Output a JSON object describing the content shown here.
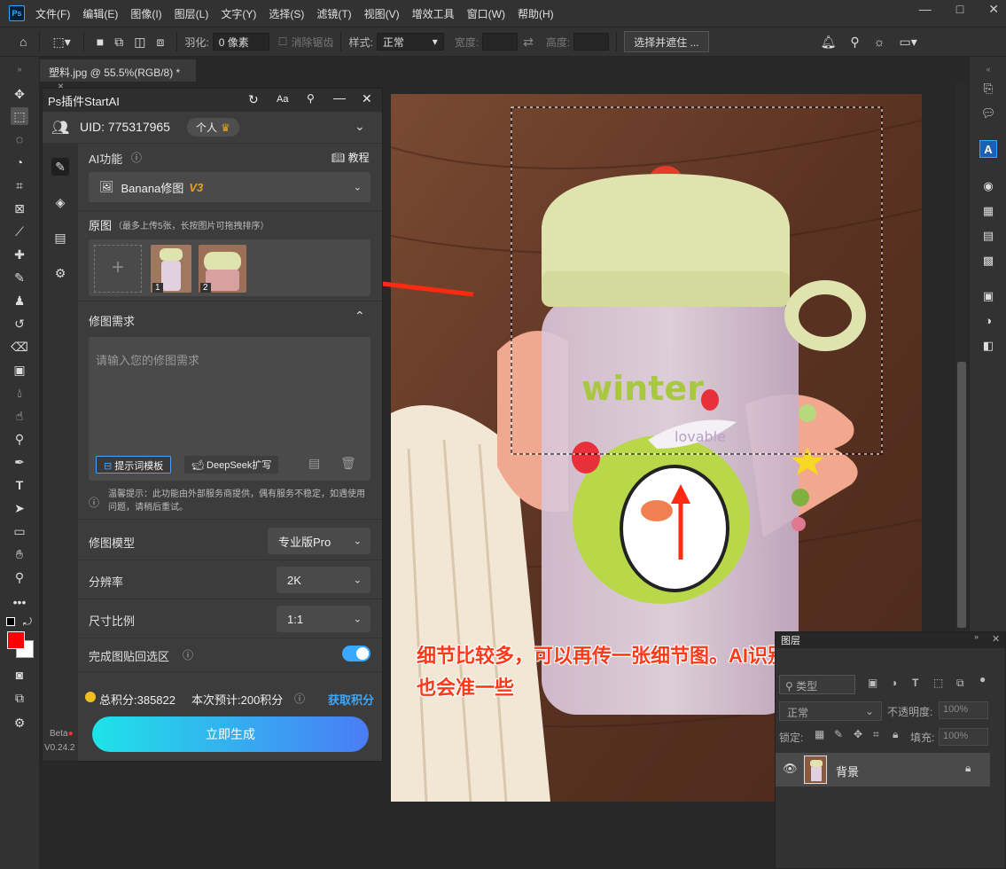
{
  "app": {
    "logo": "Ps"
  },
  "menus": [
    "文件(F)",
    "编辑(E)",
    "图像(I)",
    "图层(L)",
    "文字(Y)",
    "选择(S)",
    "滤镜(T)",
    "视图(V)",
    "增效工具",
    "窗口(W)",
    "帮助(H)"
  ],
  "window_controls": {
    "minimize": "—",
    "restore": "□",
    "close": "✕"
  },
  "options": {
    "feather_label": "羽化:",
    "feather_value": "0 像素",
    "antialias_label": "消除锯齿",
    "style_label": "样式:",
    "style_value": "正常",
    "width_label": "宽度:",
    "height_label": "高度:",
    "select_mask_button": "选择并遮住 ..."
  },
  "document_tab": {
    "title": "塑料.jpg @ 55.5%(RGB/8) *",
    "close": "×"
  },
  "plugin": {
    "title": "Ps插件StartAI",
    "font_btn": "Aa",
    "uid_label": "UID: 775317965",
    "account_type": "个人",
    "ai_func_label": "AI功能",
    "tutorial_label": "教程",
    "func_name": "Banana修图",
    "func_version": "V3",
    "source_label": "原图",
    "source_hint": "（最多上传5张，长按图片可拖拽排序）",
    "thumb_1_index": "1",
    "thumb_2_index": "2",
    "add_symbol": "+",
    "requirements_label": "修图需求",
    "requirements_placeholder": "请输入您的修图需求",
    "prompt_template_btn": "提示词模板",
    "deepseek_btn": "DeepSeek扩写",
    "notice": "温馨提示：此功能由外部服务商提供，偶有服务不稳定，如遇使用问题，请稍后重试。",
    "model_label": "修图模型",
    "model_value": "专业版Pro",
    "resolution_label": "分辨率",
    "resolution_value": "2K",
    "ratio_label": "尺寸比例",
    "ratio_value": "1:1",
    "paste_back_label": "完成图贴回选区",
    "paste_back_on": true,
    "points_total": "总积分:385822",
    "points_estimate": "本次预计:200积分",
    "get_points": "获取积分",
    "generate_btn": "立即生成",
    "beta_label": "Beta",
    "version_label": "V0.24.2"
  },
  "canvas": {
    "bottle_text_1": "winter",
    "bottle_text_2": "lovable"
  },
  "annotation": {
    "line1": "细节比较多，可以再传一张细节图。AI识别判定还原的",
    "line2": "也会准一些"
  },
  "layers_panel": {
    "tab_label": "图层",
    "filter_label": "类型",
    "blend_mode": "正常",
    "opacity_label": "不透明度:",
    "opacity_value": "100%",
    "lock_label": "锁定:",
    "fill_label": "填充:",
    "fill_value": "100%",
    "layer_name": "背景"
  },
  "colors": {
    "accent": "#31a8ff",
    "annotation_red": "#ff3a1a",
    "generate_start": "#1ee3e8",
    "generate_end": "#4a7cf6"
  }
}
